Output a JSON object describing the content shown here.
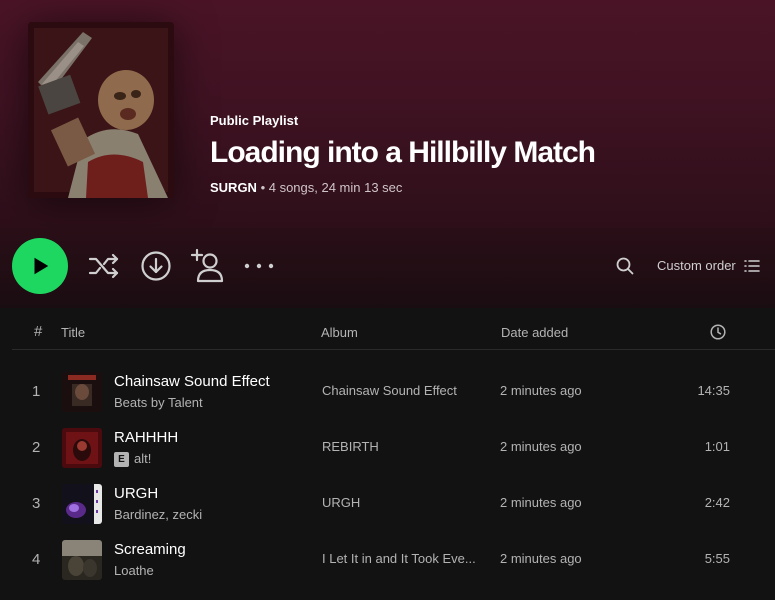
{
  "playlist": {
    "type_label": "Public Playlist",
    "title": "Loading into a Hillbilly Match",
    "owner": "SURGN",
    "info": " • 4 songs, 24 min 13 sec"
  },
  "actions": {
    "sort_label": "Custom order"
  },
  "table": {
    "columns": {
      "number": "#",
      "title": "Title",
      "album": "Album",
      "date_added": "Date added"
    },
    "tracks": [
      {
        "number": "1",
        "title": "Chainsaw Sound Effect",
        "artist": "Beats by Talent",
        "explicit": false,
        "album": "Chainsaw Sound Effect",
        "date_added": "2 minutes ago",
        "duration": "14:35"
      },
      {
        "number": "2",
        "title": "RAHHHH",
        "artist": "alt!",
        "explicit": true,
        "explicit_label": "E",
        "album": "REBIRTH",
        "date_added": "2 minutes ago",
        "duration": "1:01"
      },
      {
        "number": "3",
        "title": "URGH",
        "artist": "Bardinez, zecki",
        "explicit": false,
        "album": "URGH",
        "date_added": "2 minutes ago",
        "duration": "2:42"
      },
      {
        "number": "4",
        "title": "Screaming",
        "artist": "Loathe",
        "explicit": false,
        "album": "I Let It in and It Took Eve...",
        "date_added": "2 minutes ago",
        "duration": "5:55"
      }
    ]
  },
  "colors": {
    "accent": "#1ed760",
    "header_bg": "#4a1426",
    "background": "#121212",
    "muted_text": "#b3b3b3"
  },
  "icons": [
    "play-icon",
    "shuffle-icon",
    "download-icon",
    "add-user-icon",
    "more-icon",
    "search-icon",
    "list-icon",
    "clock-icon"
  ]
}
